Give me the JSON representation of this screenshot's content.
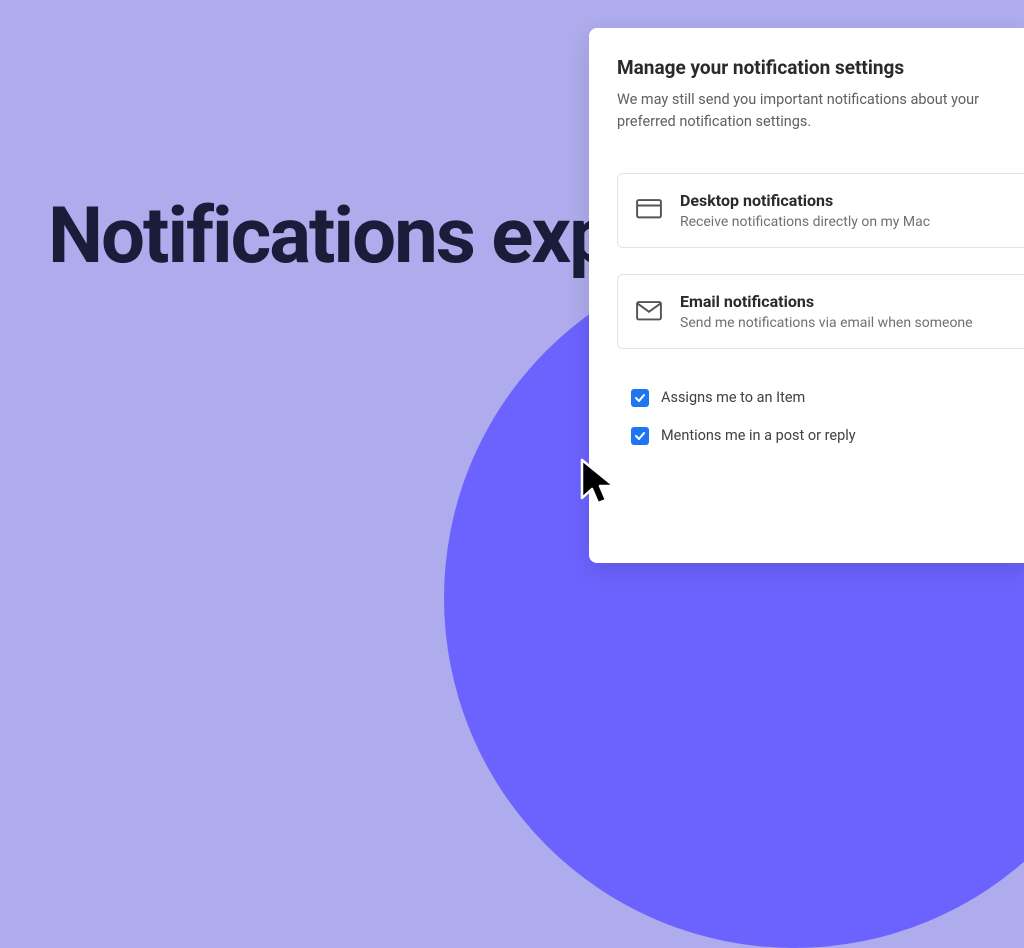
{
  "hero": "Notifications explained",
  "panel": {
    "title": "Manage your notification settings",
    "description": "We may still send you important notifications about your preferred notification settings."
  },
  "sections": {
    "desktop": {
      "title": "Desktop notifications",
      "description": "Receive notifications directly on my Mac"
    },
    "email": {
      "title": "Email notifications",
      "description": "Send me notifications via email when someone"
    }
  },
  "checkboxes": {
    "assigns": {
      "label": "Assigns me to an Item",
      "checked": true
    },
    "mentions": {
      "label": "Mentions me in a post or reply",
      "checked": true
    }
  }
}
